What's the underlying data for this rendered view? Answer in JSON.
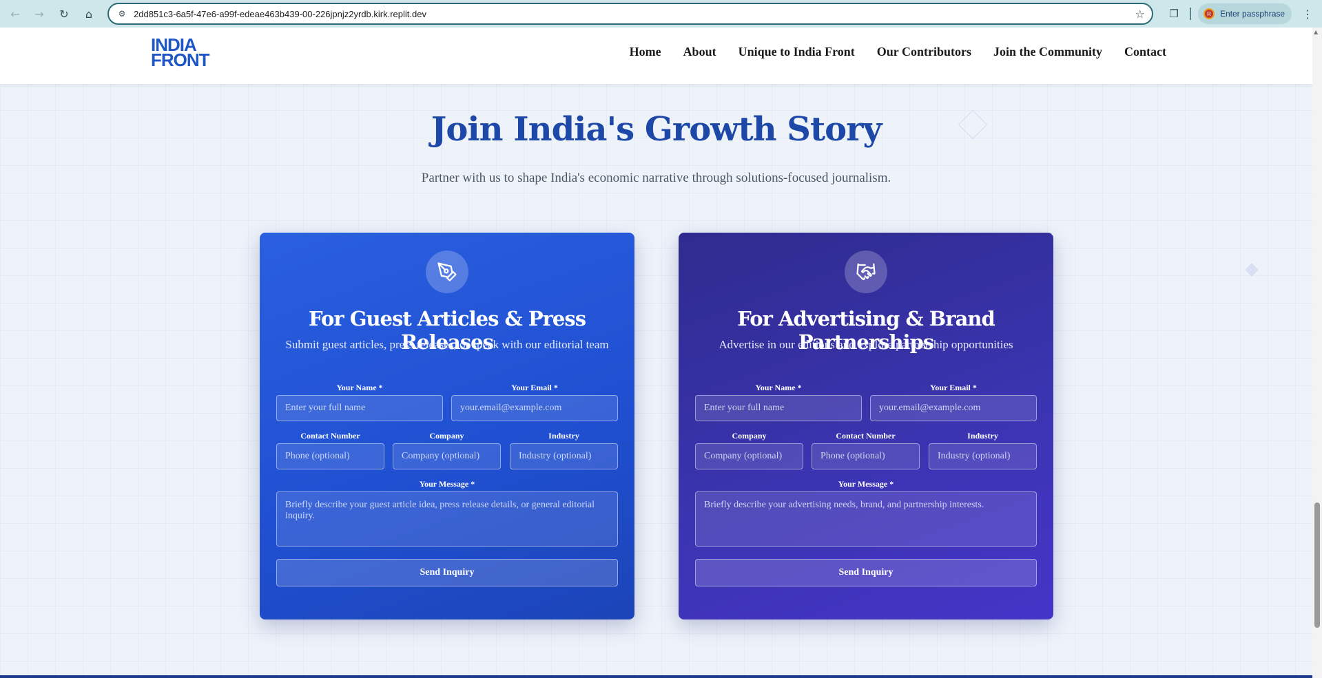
{
  "browser": {
    "url": "2dd851c3-6a5f-47e6-a99f-edeae463b439-00-226jpnjz2yrdb.kirk.replit.dev",
    "profile_label": "Enter passphrase",
    "profile_initial": "R"
  },
  "header": {
    "logo_line1": "INDIA",
    "logo_line2": "FRONT",
    "nav": [
      "Home",
      "About",
      "Unique to India Front",
      "Our Contributors",
      "Join the Community",
      "Contact"
    ]
  },
  "hero": {
    "title": "Join India's Growth Story",
    "subtitle": "Partner with us to shape India's economic narrative through solutions-focused journalism."
  },
  "cards": [
    {
      "icon": "pen-nib-icon",
      "title": "For Guest Articles & Press Releases",
      "subtitle": "Submit guest articles, press releases, or speak with our editorial team",
      "name_label": "Your Name *",
      "name_placeholder": "Enter your full name",
      "email_label": "Your Email *",
      "email_placeholder": "your.email@example.com",
      "row2": [
        {
          "label": "Contact Number",
          "placeholder": "Phone (optional)"
        },
        {
          "label": "Company",
          "placeholder": "Company (optional)"
        },
        {
          "label": "Industry",
          "placeholder": "Industry (optional)"
        }
      ],
      "message_label": "Your Message *",
      "message_placeholder": "Briefly describe your guest article idea, press release details, or general editorial inquiry.",
      "button": "Send Inquiry",
      "color": "#2255d6"
    },
    {
      "icon": "handshake-icon",
      "title": "For Advertising & Brand Partnerships",
      "subtitle": "Advertise in our editions and explore partnership opportunities",
      "name_label": "Your Name *",
      "name_placeholder": "Enter your full name",
      "email_label": "Your Email *",
      "email_placeholder": "your.email@example.com",
      "row2": [
        {
          "label": "Company",
          "placeholder": "Company (optional)"
        },
        {
          "label": "Contact Number",
          "placeholder": "Phone (optional)"
        },
        {
          "label": "Industry",
          "placeholder": "Industry (optional)"
        }
      ],
      "message_label": "Your Message *",
      "message_placeholder": "Briefly describe your advertising needs, brand, and partnership interests.",
      "button": "Send Inquiry",
      "color": "#3a33ad"
    }
  ]
}
